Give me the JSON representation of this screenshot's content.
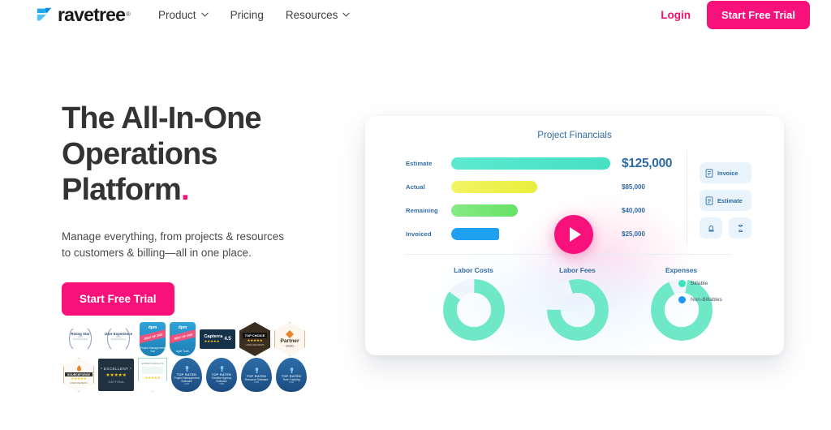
{
  "header": {
    "logo_text": "ravetree",
    "logo_registered": "®",
    "logo_icon": "ravetree-arrow-logo",
    "nav": [
      {
        "label": "Product",
        "has_chevron": true
      },
      {
        "label": "Pricing",
        "has_chevron": false
      },
      {
        "label": "Resources",
        "has_chevron": true
      }
    ],
    "login_label": "Login",
    "cta_label": "Start Free Trial"
  },
  "hero": {
    "headline_line1": "The All-In-One",
    "headline_line2": "Operations",
    "headline_line3": "Platform",
    "headline_dot": ".",
    "subtext": "Manage everything, from projects & resources to customers & billing—all in one place.",
    "cta_label": "Start Free Trial"
  },
  "badges": {
    "row1": [
      {
        "type": "laurel",
        "title": "Rising Star",
        "sub": "2020",
        "source": "FinancesOnline"
      },
      {
        "type": "laurel",
        "title": "User Experience",
        "sub": "2020",
        "source": "FinancesOnline"
      },
      {
        "type": "ribbon",
        "top": "dpm",
        "ribbon": "BEST OF 2020",
        "bottom": "Project Management Tool"
      },
      {
        "type": "ribbon",
        "top": "dpm",
        "ribbon": "BEST OF 2020",
        "bottom": "Agile Tools"
      },
      {
        "type": "capterra",
        "name": "Capterra",
        "rating": "4.5"
      },
      {
        "type": "hex-dark",
        "tag": "TOP CHOICE",
        "sub": "USER REVIEWS"
      },
      {
        "type": "hex-light",
        "title": "Partner",
        "year": "- 2020 -"
      }
    ],
    "row2": [
      {
        "type": "sourceforge",
        "label": "SOURCEFORGE",
        "sub": "USER REVIEWS"
      },
      {
        "type": "excellent",
        "top": "* EXCELLENT *",
        "brand": "DAYTONA"
      },
      {
        "type": "shield",
        "top": "EXPERT INSIGHTS"
      },
      {
        "type": "toprated",
        "top": "TOP RATED",
        "mid": "Project Management Software",
        "bot": "CRM"
      },
      {
        "type": "toprated",
        "top": "TOP RATED",
        "mid": "Creative Agency Software",
        "bot": "CRM"
      },
      {
        "type": "toprated",
        "top": "TOP RATED",
        "mid": "Resource Software",
        "bot": "CRM"
      },
      {
        "type": "toprated",
        "top": "TOP RATED",
        "mid": "Time Tracking",
        "bot": "CRM"
      }
    ]
  },
  "dashboard": {
    "title": "Project Financials",
    "side_actions": [
      {
        "label": "Invoice",
        "icon": "invoice-document-icon"
      },
      {
        "label": "Estimate",
        "icon": "estimate-document-icon"
      }
    ],
    "side_mini_actions": [
      {
        "icon": "stamp-icon"
      },
      {
        "icon": "hourglass-icon"
      }
    ],
    "play_button": {
      "icon": "play-icon"
    },
    "legend": [
      {
        "label": "Billable",
        "color": "#3be3bd"
      },
      {
        "label": "Non-Billables",
        "color": "#2196f3"
      }
    ]
  },
  "chart_data": [
    {
      "type": "bar",
      "title": "Project Financials",
      "orientation": "horizontal",
      "categories": [
        "Estimate",
        "Actual",
        "Remaining",
        "Invoiced"
      ],
      "values": [
        125000,
        85000,
        40000,
        25000
      ],
      "value_labels": [
        "$125,000",
        "$85,000",
        "$40,000",
        "$25,000"
      ],
      "colors": [
        "#55e8cd",
        "#ecf04a",
        "#72e571",
        "#22a2f0"
      ],
      "bar_fractions": [
        1.0,
        0.54,
        0.42,
        0.3
      ],
      "xlabel": "",
      "ylabel": "",
      "grid": false,
      "legend_position": "none"
    },
    {
      "type": "pie",
      "title": "Labor Costs",
      "subtype": "donut",
      "labels": [
        "Billable",
        "Non-Billables"
      ],
      "values": [
        85,
        15
      ],
      "colors": [
        "#6fe8c8",
        "#eef6fb"
      ],
      "legend_position": "right"
    },
    {
      "type": "pie",
      "title": "Labor Fees",
      "subtype": "donut",
      "labels": [
        "Billable",
        "Non-Billables"
      ],
      "values": [
        80,
        20
      ],
      "colors": [
        "#6fe8c8",
        "#eef6fb"
      ],
      "legend_position": "right"
    },
    {
      "type": "pie",
      "title": "Expenses",
      "subtype": "donut",
      "labels": [
        "Billable",
        "Non-Billables"
      ],
      "values": [
        90,
        10
      ],
      "colors": [
        "#6fe8c8",
        "#eef6fb"
      ],
      "legend_position": "right"
    }
  ]
}
